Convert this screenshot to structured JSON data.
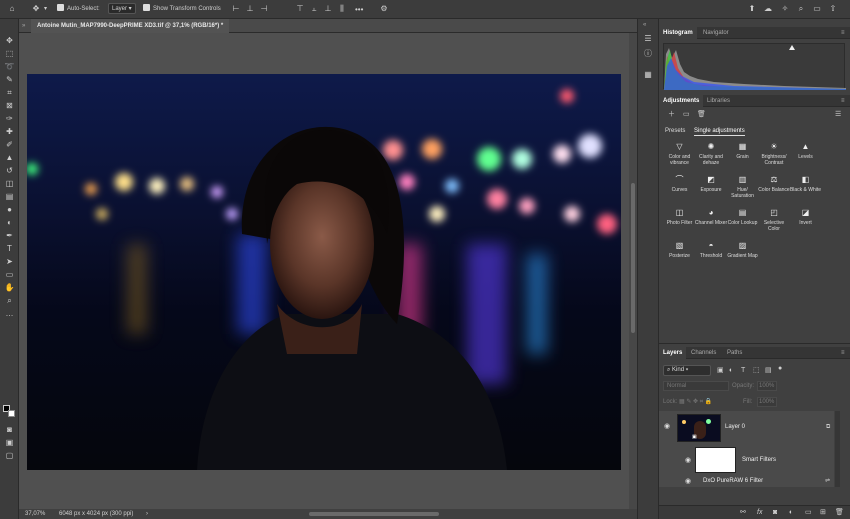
{
  "toolbar": {
    "home_icon": "home-icon",
    "auto_select_label": "Auto-Select:",
    "auto_select_value": "Layer",
    "show_transform_label": "Show Transform Controls",
    "more_label": "•••"
  },
  "document": {
    "tab_title": "Antoine Mutin_MAP7990-DeepPRIME XD3.tif @ 37,1% (RGB/16*) *",
    "zoom": "37,07%",
    "dimensions": "6048 px x 4024 px (300 ppi)"
  },
  "panels": {
    "histogram_tab": "Histogram",
    "navigator_tab": "Navigator",
    "adjustments_tab": "Adjustments",
    "libraries_tab": "Libraries",
    "presets_tab": "Presets",
    "single_adjustments_tab": "Single adjustments",
    "adjustments": [
      {
        "label": "Color and vibrance",
        "icon": "triangle-icon"
      },
      {
        "label": "Clarity and dehaze",
        "icon": "sparkle-icon"
      },
      {
        "label": "Grain",
        "icon": "grain-icon"
      },
      {
        "label": "Brightness/ Contrast",
        "icon": "sun-icon"
      },
      {
        "label": "Levels",
        "icon": "levels-icon"
      },
      {
        "label": "Curves",
        "icon": "curves-icon"
      },
      {
        "label": "Exposure",
        "icon": "exposure-icon"
      },
      {
        "label": "Hue/ Saturation",
        "icon": "hue-icon"
      },
      {
        "label": "Color Balance",
        "icon": "balance-icon"
      },
      {
        "label": "Black & White",
        "icon": "bw-icon"
      },
      {
        "label": "Photo Filter",
        "icon": "photo-filter-icon"
      },
      {
        "label": "Channel Mixer",
        "icon": "channel-mixer-icon"
      },
      {
        "label": "Color Lookup",
        "icon": "lookup-icon"
      },
      {
        "label": "Selective Color",
        "icon": "selective-icon"
      },
      {
        "label": "Invert",
        "icon": "invert-icon"
      },
      {
        "label": "Posterize",
        "icon": "posterize-icon"
      },
      {
        "label": "Threshold",
        "icon": "threshold-icon"
      },
      {
        "label": "Gradient Map",
        "icon": "gradient-icon"
      }
    ],
    "layers_tab": "Layers",
    "channels_tab": "Channels",
    "paths_tab": "Paths",
    "kind_filter": "Kind",
    "blend_mode": "Normal",
    "opacity_label": "Opacity:",
    "opacity_value": "100%",
    "lock_label": "Lock:",
    "fill_label": "Fill:",
    "fill_value": "100%",
    "layers": [
      {
        "name": "Layer 0"
      },
      {
        "name": "Smart Filters"
      },
      {
        "name": "DxO PureRAW 6 Filter"
      }
    ],
    "footer_icons": [
      "link-icon",
      "fx-icon",
      "mask-icon",
      "adjustment-icon",
      "folder-icon",
      "new-layer-icon",
      "trash-icon"
    ]
  },
  "colors": {
    "panel_bg": "#404040",
    "app_bg": "#535353",
    "accent": "#1473e6"
  }
}
